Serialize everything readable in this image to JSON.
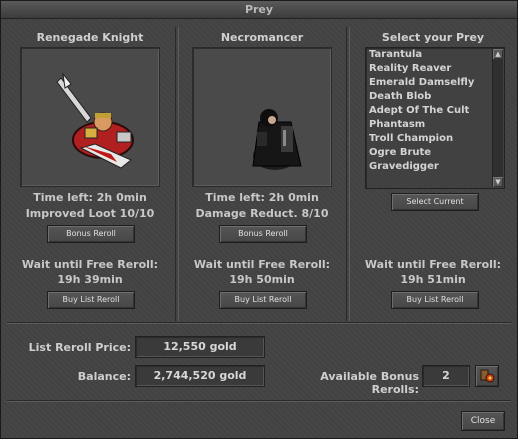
{
  "window": {
    "title": "Prey"
  },
  "slots": [
    {
      "name": "Renegade Knight",
      "time_left": "Time left: 2h 0min",
      "bonus": "Improved Loot 10/10",
      "bonus_reroll_label": "Bonus Reroll",
      "wait_text": "Wait until Free Reroll:",
      "wait_time": "19h 39min",
      "buy_list_reroll_label": "Buy List Reroll"
    },
    {
      "name": "Necromancer",
      "time_left": "Time left: 2h 0min",
      "bonus": "Damage Reduct. 8/10",
      "bonus_reroll_label": "Bonus Reroll",
      "wait_text": "Wait until Free Reroll:",
      "wait_time": "19h 50min",
      "buy_list_reroll_label": "Buy List Reroll"
    },
    {
      "name": "Select your Prey",
      "select_current_label": "Select Current",
      "wait_text": "Wait until Free Reroll:",
      "wait_time": "19h 51min",
      "buy_list_reroll_label": "Buy List Reroll",
      "creatures": [
        "Tarantula",
        "Reality Reaver",
        "Emerald Damselfly",
        "Death Blob",
        "Adept Of The Cult",
        "Phantasm",
        "Troll Champion",
        "Ogre Brute",
        "Gravedigger"
      ]
    }
  ],
  "footer": {
    "list_reroll_price_label": "List Reroll Price:",
    "list_reroll_price": "12,550 gold",
    "balance_label": "Balance:",
    "balance": "2,744,520 gold",
    "bonus_rerolls_label": "Available Bonus Rerolls:",
    "bonus_rerolls": "2",
    "close_label": "Close"
  },
  "colors": {
    "panel": "#434343",
    "text": "#c8c8c8",
    "field": "#3a3a3a"
  },
  "icons": [
    "scroll-up-icon",
    "scroll-down-icon",
    "bonus-reroll-icon"
  ]
}
